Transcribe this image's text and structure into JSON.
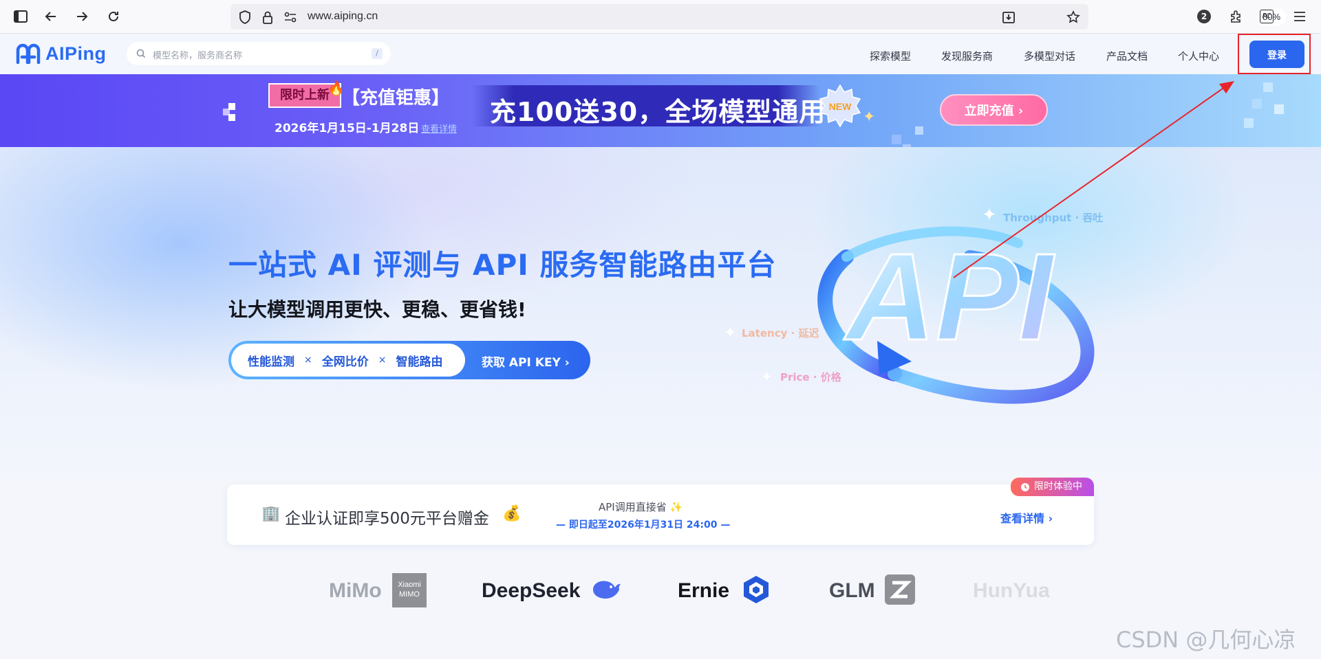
{
  "browser": {
    "url": "www.aiping.cn",
    "zoom": "80%",
    "notification_count": "2",
    "extension_label": "FC"
  },
  "header": {
    "logo_text": "AIPing",
    "search_placeholder": "模型名称，服务商名称",
    "search_shortcut": "/",
    "nav": [
      "探索模型",
      "发现服务商",
      "多模型对话",
      "产品文档",
      "个人中心"
    ],
    "login_label": "登录"
  },
  "promo": {
    "tag": "限时上新",
    "title": "【充值钜惠】",
    "date": "2026年1月15日-1月28日",
    "detail_link": "查看详情",
    "slogan": "充100送30，全场模型通用",
    "new_badge": "NEW",
    "button": "立即充值 ›"
  },
  "hero": {
    "title": "一站式 AI 评测与 API 服务智能路由平台",
    "subtitle": "让大模型调用更快、更稳、更省钱!",
    "features": [
      "性能监测",
      "全网比价",
      "智能路由"
    ],
    "separator": "×",
    "cta": "获取 API KEY ›",
    "graphic_text": "API",
    "metrics": {
      "throughput": "Throughput · 吞吐",
      "latency": "Latency · 延迟",
      "price": "Price · 价格"
    }
  },
  "enterprise_card": {
    "main": "企业认证即享500元平台赠金",
    "api_text": "API调用直接省 ✨",
    "deadline": "— 即日起至2026年1月31日 24:00 —",
    "link": "查看详情 ›",
    "badge": "限时体验中"
  },
  "models": {
    "mimo": "MiMo",
    "mimo_mark_top": "Xiaomi",
    "mimo_mark_bottom": "MIMO",
    "deepseek": "DeepSeek",
    "ernie": "Ernie",
    "glm": "GLM",
    "hunyuan": "HunYua"
  },
  "watermark": "CSDN @几何心凉",
  "colors": {
    "brand_blue": "#2b66ee",
    "highlight_red": "#e8232a",
    "promo_pink": "#ff6aa3"
  }
}
